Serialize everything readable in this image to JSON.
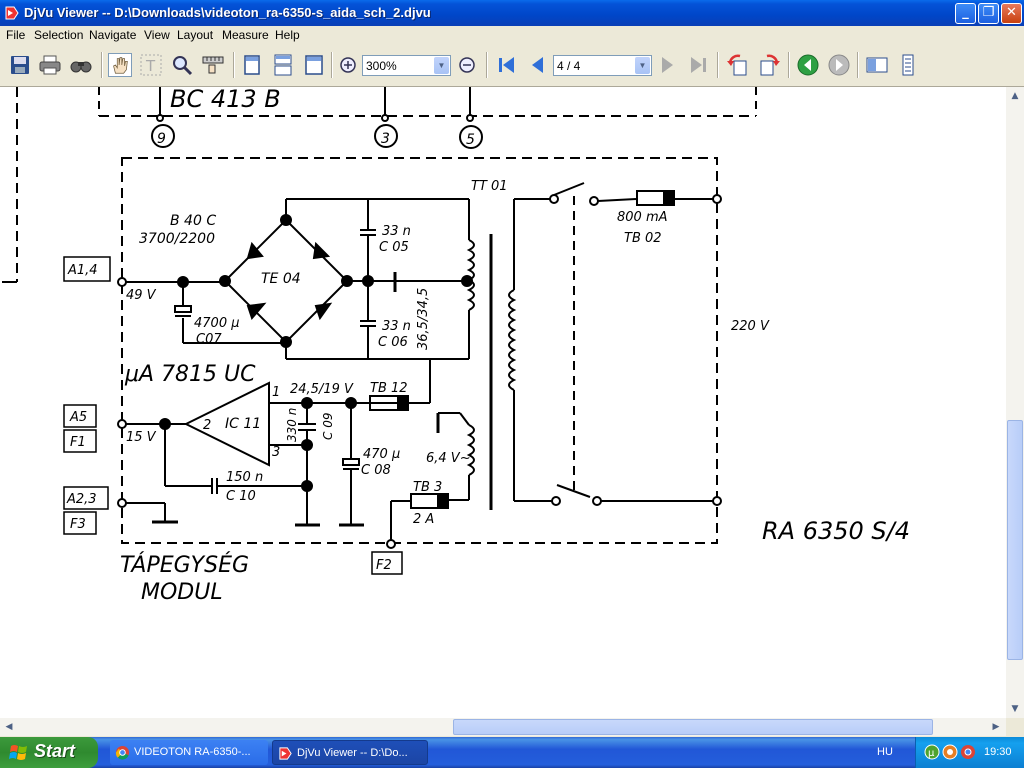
{
  "window": {
    "title": "DjVu Viewer -- D:\\Downloads\\videoton_ra-6350-s_aida_sch_2.djvu",
    "min_icon": "minimize-icon",
    "max_icon": "maximize-icon",
    "close_icon": "close-icon"
  },
  "menu": {
    "items": [
      "File",
      "Selection",
      "Navigate",
      "View",
      "Layout",
      "Measure",
      "Help"
    ]
  },
  "toolbar": {
    "zoom_value": "300%",
    "page_value": "4 / 4",
    "icons": [
      "save-icon",
      "print-icon",
      "find-icon",
      "hand-tool-icon",
      "text-select-icon",
      "zoom-tool-icon",
      "measure-icon",
      "single-page-icon",
      "continuous-page-icon",
      "facing-page-icon",
      "zoom-in-icon",
      "zoom-out-icon",
      "first-page-icon",
      "prev-page-icon",
      "next-page-icon",
      "last-page-icon",
      "rotate-left-icon",
      "rotate-right-icon",
      "go-back-icon",
      "go-forward-icon",
      "thumbnails-icon",
      "bookmarks-icon"
    ]
  },
  "schematic": {
    "transistor_label": "BC 413 B",
    "pins_top": [
      "9",
      "3",
      "5"
    ],
    "transformer": "TT 01",
    "bridge_type": "B 40 C",
    "bridge_rating": "3700/2200",
    "bridge_name": "TE 04",
    "c05_value": "33 n",
    "c05_name": "C 05",
    "c06_value": "33 n",
    "c06_name": "C 06",
    "secondary_voltage": "36,5/34,5",
    "c07_value": "4700 μ",
    "c07_name": "C07",
    "fuse_tb02_rating": "800 mA",
    "fuse_tb02_name": "TB 02",
    "mains_voltage": "220 V",
    "conn_a14": "A1,4",
    "v49": "49 V",
    "regulator": "μA 7815 UC",
    "reg_in_voltage": "24,5/19 V",
    "fuse_tb12": "TB 12",
    "conn_a5": "A5",
    "conn_f1": "F1",
    "v15": "15 V",
    "ic_name": "IC 11",
    "pin1": "1",
    "pin2": "2",
    "pin3": "3",
    "c09_value": "330 n",
    "c09_name": "C 09",
    "c08_value": "470 μ",
    "c08_name": "C 08",
    "c10_value": "150 n",
    "c10_name": "C 10",
    "heater_voltage": "6,4 V~",
    "fuse_tb3_name": "TB 3",
    "fuse_tb3_rating": "2 A",
    "conn_a23": "A2,3",
    "conn_f3": "F3",
    "conn_f2": "F2",
    "model": "RA 6350 S/4",
    "module_line1": "TÁPEGYSÉG",
    "module_line2": "MODUL"
  },
  "taskbar": {
    "start_label": "Start",
    "tasks": [
      {
        "label": "VIDEOTON RA-6350-...",
        "icon": "chrome-icon"
      },
      {
        "label": "DjVu Viewer -- D:\\Do...",
        "icon": "djvu-icon"
      }
    ],
    "language": "HU",
    "clock": "19:30"
  }
}
